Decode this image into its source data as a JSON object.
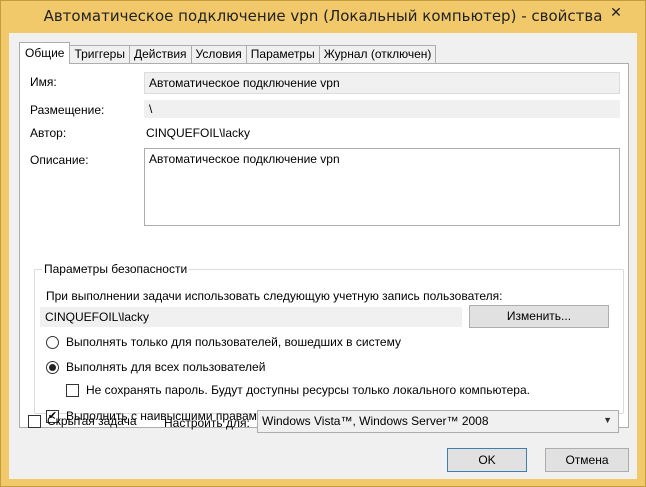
{
  "window": {
    "title": "Автоматическое подключение vpn (Локальный компьютер) - свойства"
  },
  "tabs": [
    {
      "label": "Общие",
      "active": true
    },
    {
      "label": "Триггеры"
    },
    {
      "label": "Действия"
    },
    {
      "label": "Условия"
    },
    {
      "label": "Параметры"
    },
    {
      "label": "Журнал (отключен)"
    }
  ],
  "general": {
    "name_label": "Имя:",
    "name_value": "Автоматическое подключение vpn",
    "location_label": "Размещение:",
    "location_value": "\\",
    "author_label": "Автор:",
    "author_value": "CINQUEFOIL\\lacky",
    "description_label": "Описание:",
    "description_value": "Автоматическое подключение vpn"
  },
  "security": {
    "legend": "Параметры безопасности",
    "account_prompt": "При выполнении задачи использовать следующую учетную запись пользователя:",
    "account_value": "CINQUEFOIL\\lacky",
    "change_button": "Изменить...",
    "radio_logged_on": "Выполнять только для пользователей, вошедших в систему",
    "radio_all_users": "Выполнять для всех пользователей",
    "no_store_password": "Не сохранять пароль. Будут доступны ресурсы только локального компьютера.",
    "highest_privileges": "Выполнить с наивысшими правами"
  },
  "bottom": {
    "hidden_task": "Скрытая задача",
    "configure_label": "Настроить для:",
    "configure_value": "Windows Vista™, Windows Server™ 2008"
  },
  "buttons": {
    "ok": "OK",
    "cancel": "Отмена"
  },
  "icons": {
    "close": "close-icon",
    "dropdown": "chevron-down-icon",
    "check": "checkmark-icon"
  },
  "colors": {
    "title_bar": "#f1c96a",
    "default_button_border": "#3c7fb1"
  }
}
